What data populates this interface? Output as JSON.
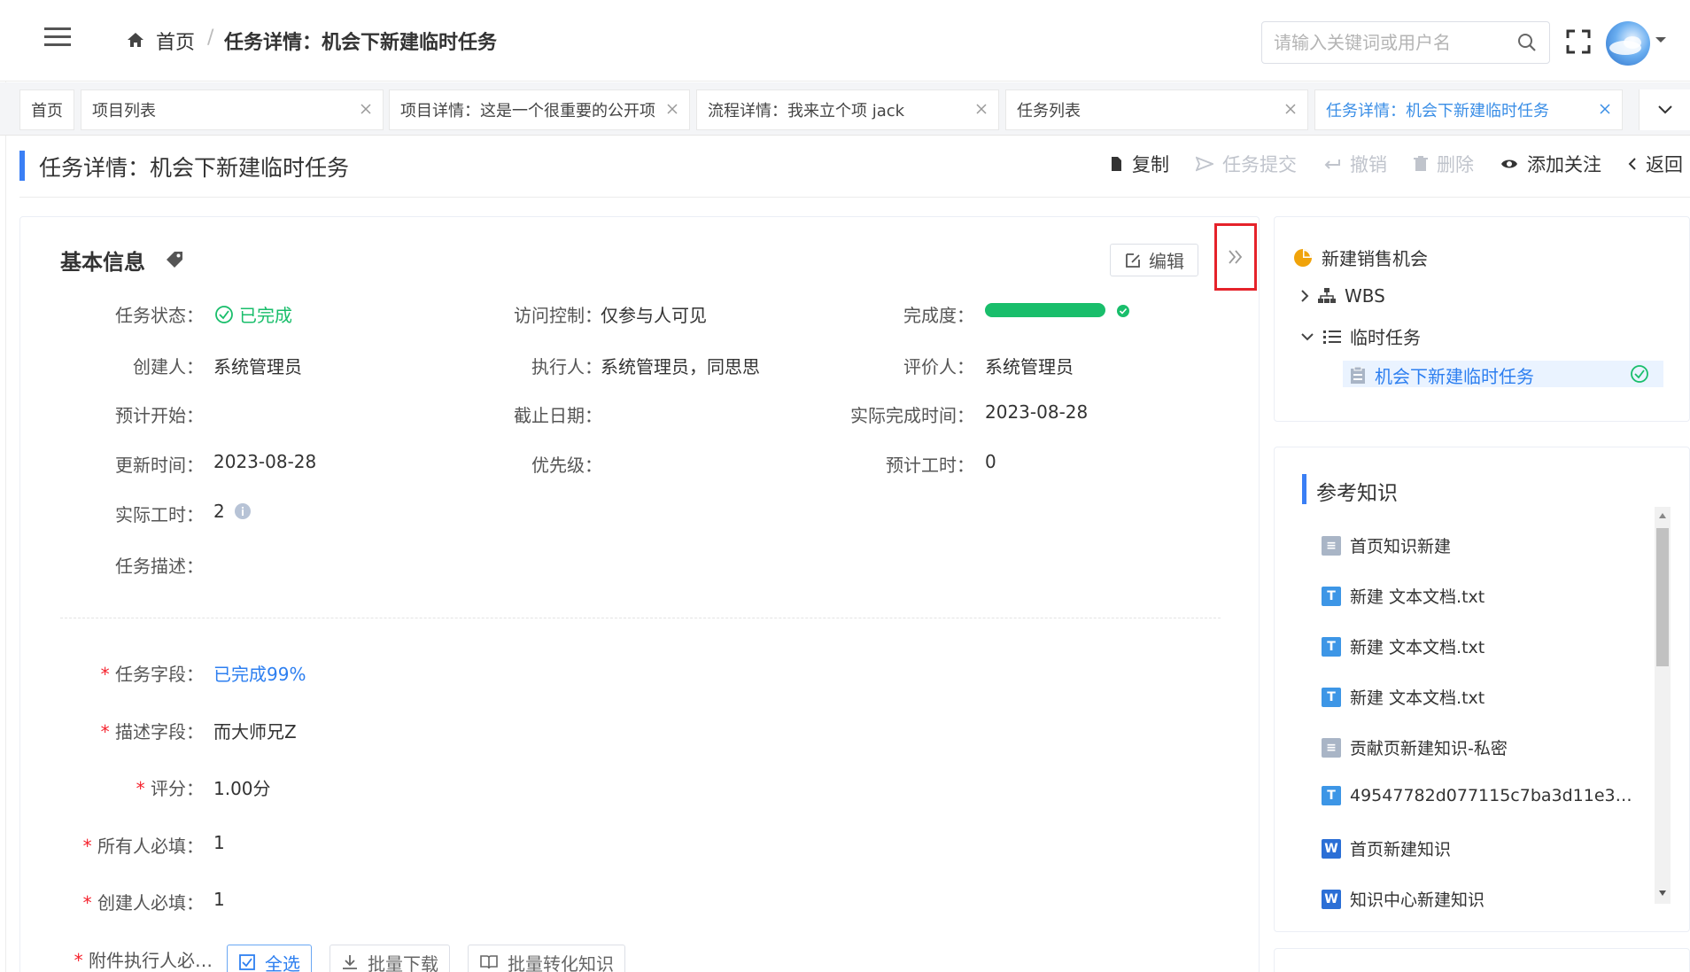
{
  "header": {
    "breadcrumb_home": "首页",
    "breadcrumb_separator": "/",
    "breadcrumb_current": "任务详情：机会下新建临时任务",
    "search_placeholder": "请输入关键词或用户名"
  },
  "tabs": [
    {
      "label": "首页",
      "closable": false
    },
    {
      "label": "项目列表",
      "closable": true
    },
    {
      "label": "项目详情：这是一个很重要的公开项",
      "closable": true
    },
    {
      "label": "流程详情：我来立个项 jack",
      "closable": true
    },
    {
      "label": "任务列表",
      "closable": true
    },
    {
      "label": "任务详情：机会下新建临时任务",
      "closable": true,
      "active": true
    }
  ],
  "page": {
    "title": "任务详情：机会下新建临时任务",
    "actions": {
      "copy": "复制",
      "submit": "任务提交",
      "revoke": "撤销",
      "delete": "删除",
      "follow": "添加关注",
      "back": "返回"
    }
  },
  "basic_info": {
    "section_title": "基本信息",
    "edit_label": "编辑",
    "status_label": "任务状态：",
    "status_value": "已完成",
    "access_label": "访问控制：",
    "access_value": "仅参与人可见",
    "completion_label": "完成度：",
    "completion_percent": 100,
    "creator_label": "创建人：",
    "creator_value": "系统管理员",
    "executor_label": "执行人：",
    "executor_value": "系统管理员，同思思",
    "evaluator_label": "评价人：",
    "evaluator_value": "系统管理员",
    "planned_start_label": "预计开始：",
    "deadline_label": "截止日期：",
    "actual_finish_label": "实际完成时间：",
    "actual_finish_value": "2023-08-28",
    "updated_label": "更新时间：",
    "updated_value": "2023-08-28",
    "priority_label": "优先级：",
    "est_hours_label": "预计工时：",
    "est_hours_value": "0",
    "actual_hours_label": "实际工时：",
    "actual_hours_value": "2",
    "desc_label": "任务描述："
  },
  "custom_fields": {
    "required_mark": "*",
    "task_field_label": "任务字段：",
    "task_field_value": "已完成99%",
    "desc_field_label": "描述字段：",
    "desc_field_value": "而大师兄Z",
    "score_label": "评分：",
    "score_value": "1.00分",
    "all_required_label": "所有人必填：",
    "all_required_value": "1",
    "creator_required_label": "创建人必填：",
    "creator_required_value": "1",
    "attachment_label": "附件执行人必…",
    "select_all": "全选",
    "batch_download": "批量下载",
    "batch_convert": "批量转化知识"
  },
  "tree": {
    "root": "新建销售机会",
    "wbs": "WBS",
    "temp_tasks": "临时任务",
    "current_task": "机会下新建临时任务"
  },
  "knowledge": {
    "title": "参考知识",
    "items": [
      {
        "type": "doc",
        "name": "首页知识新建"
      },
      {
        "type": "txt",
        "name": "新建 文本文档.txt"
      },
      {
        "type": "txt",
        "name": "新建 文本文档.txt"
      },
      {
        "type": "txt",
        "name": "新建 文本文档.txt"
      },
      {
        "type": "doc",
        "name": "贡献页新建知识-私密"
      },
      {
        "type": "txt",
        "name": "49547782d077115c7ba3d11e3400..."
      },
      {
        "type": "word",
        "name": "首页新建知识"
      },
      {
        "type": "word",
        "name": "知识中心新建知识"
      }
    ]
  },
  "colors": {
    "accent": "#3a7ff5",
    "success": "#19be6b",
    "required": "#f5222d",
    "highlight_box": "#e5222a"
  }
}
